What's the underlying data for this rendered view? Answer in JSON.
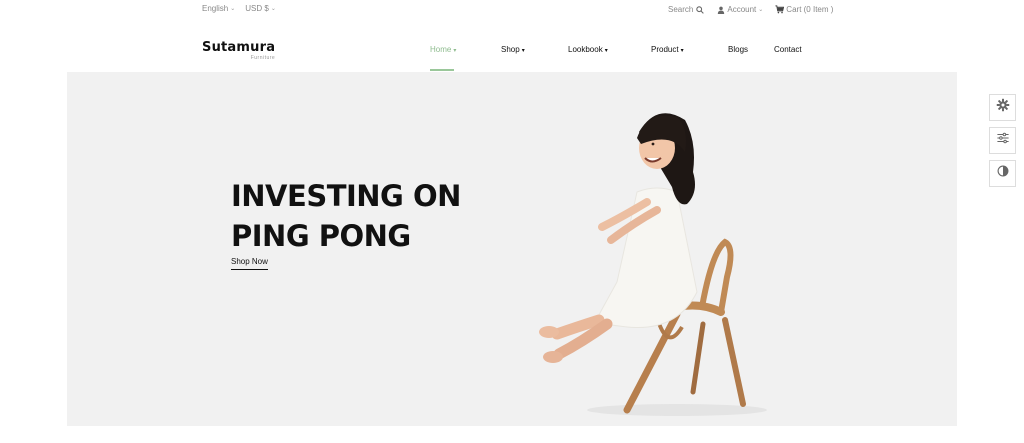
{
  "topbar": {
    "language": "English",
    "currency": "USD $",
    "search_label": "Search",
    "account_label": "Account",
    "cart_label": "Cart (0 Item )"
  },
  "header": {
    "brand": "Sutamura",
    "brand_sub": "Furniture"
  },
  "nav": {
    "items": [
      {
        "label": "Home",
        "dropdown": true,
        "active": true
      },
      {
        "label": "Shop",
        "dropdown": true
      },
      {
        "label": "Lookbook",
        "dropdown": true
      },
      {
        "label": "Product",
        "dropdown": true
      },
      {
        "label": "Blogs",
        "dropdown": false
      },
      {
        "label": "Contact",
        "dropdown": false
      }
    ]
  },
  "hero": {
    "headline_line1": "INVESTING ON",
    "headline_line2": "PING PONG",
    "cta_label": "Shop Now",
    "image_alt": "child-on-wooden-chair"
  },
  "side_tools": [
    {
      "name": "settings-icon"
    },
    {
      "name": "sliders-icon"
    },
    {
      "name": "contrast-icon"
    }
  ],
  "colors": {
    "accent": "#8fbc8f",
    "hero_bg": "#f1f1f1",
    "text": "#111111",
    "muted": "#888888"
  }
}
